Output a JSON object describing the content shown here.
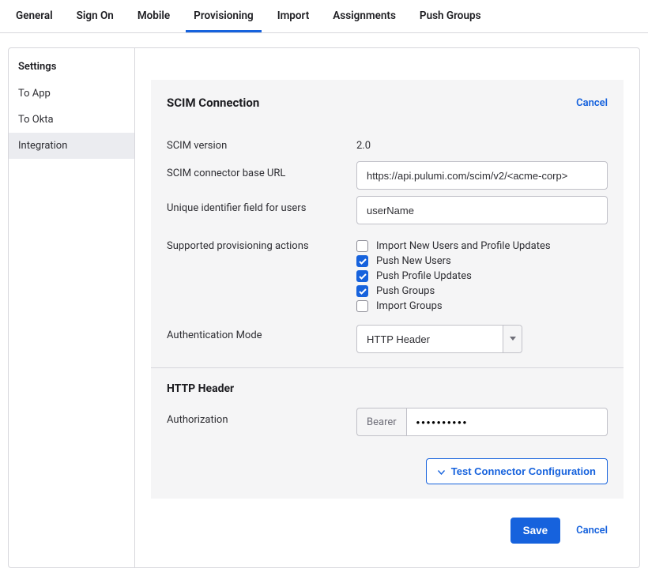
{
  "tabs": {
    "items": [
      {
        "label": "General"
      },
      {
        "label": "Sign On"
      },
      {
        "label": "Mobile"
      },
      {
        "label": "Provisioning"
      },
      {
        "label": "Import"
      },
      {
        "label": "Assignments"
      },
      {
        "label": "Push Groups"
      }
    ],
    "activeIndex": 3
  },
  "sidebar": {
    "heading": "Settings",
    "items": [
      {
        "label": "To App"
      },
      {
        "label": "To Okta"
      },
      {
        "label": "Integration"
      }
    ],
    "selectedIndex": 2
  },
  "panel": {
    "title": "SCIM Connection",
    "cancel": "Cancel",
    "scimVersion": {
      "label": "SCIM version",
      "value": "2.0"
    },
    "baseUrl": {
      "label": "SCIM connector base URL",
      "value": "https://api.pulumi.com/scim/v2/<acme-corp>"
    },
    "uniqueId": {
      "label": "Unique identifier field for users",
      "value": "userName"
    },
    "actions": {
      "label": "Supported provisioning actions",
      "options": [
        {
          "label": "Import New Users and Profile Updates",
          "checked": false
        },
        {
          "label": "Push New Users",
          "checked": true
        },
        {
          "label": "Push Profile Updates",
          "checked": true
        },
        {
          "label": "Push Groups",
          "checked": true
        },
        {
          "label": "Import Groups",
          "checked": false
        }
      ]
    },
    "authMode": {
      "label": "Authentication Mode",
      "value": "HTTP Header"
    },
    "httpHeader": {
      "title": "HTTP Header",
      "authLabel": "Authorization",
      "prefix": "Bearer",
      "value": "••••••••••"
    },
    "testButton": "Test Connector Configuration"
  },
  "footer": {
    "save": "Save",
    "cancel": "Cancel"
  }
}
